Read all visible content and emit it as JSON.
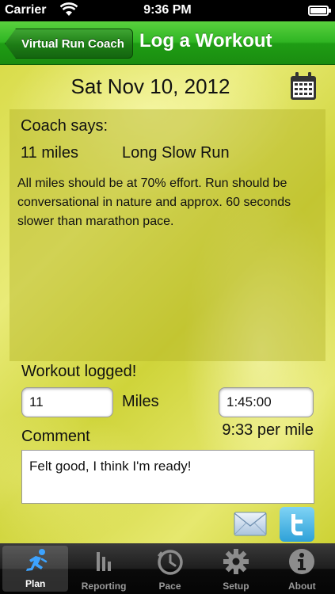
{
  "status_bar": {
    "carrier": "Carrier",
    "time": "9:36 PM"
  },
  "nav": {
    "back_label": "Virtual Run Coach",
    "title": "Log a Workout"
  },
  "date": "Sat Nov 10, 2012",
  "coach": {
    "heading": "Coach says:",
    "miles": "11 miles",
    "type": "Long Slow Run",
    "description": "All miles should be at 70% effort.  Run should be conversational in nature and approx. 60 seconds slower than marathon pace."
  },
  "workout": {
    "logged_label": "Workout logged!",
    "miles_value": "11",
    "miles_unit": "Miles",
    "time_value": "1:45:00",
    "pace": "9:33 per mile",
    "comment_label": "Comment",
    "comment_value": "Felt good, I think I'm ready!"
  },
  "tabs": [
    {
      "label": "Plan",
      "icon": "runner-icon",
      "active": true
    },
    {
      "label": "Reporting",
      "icon": "bar-chart-icon",
      "active": false
    },
    {
      "label": "Pace",
      "icon": "stopwatch-icon",
      "active": false
    },
    {
      "label": "Setup",
      "icon": "gear-icon",
      "active": false
    },
    {
      "label": "About",
      "icon": "info-icon",
      "active": false
    }
  ],
  "colors": {
    "nav_green": "#2fb523",
    "background_yellow": "#dfe25a",
    "twitter_blue": "#4fb8e8"
  }
}
